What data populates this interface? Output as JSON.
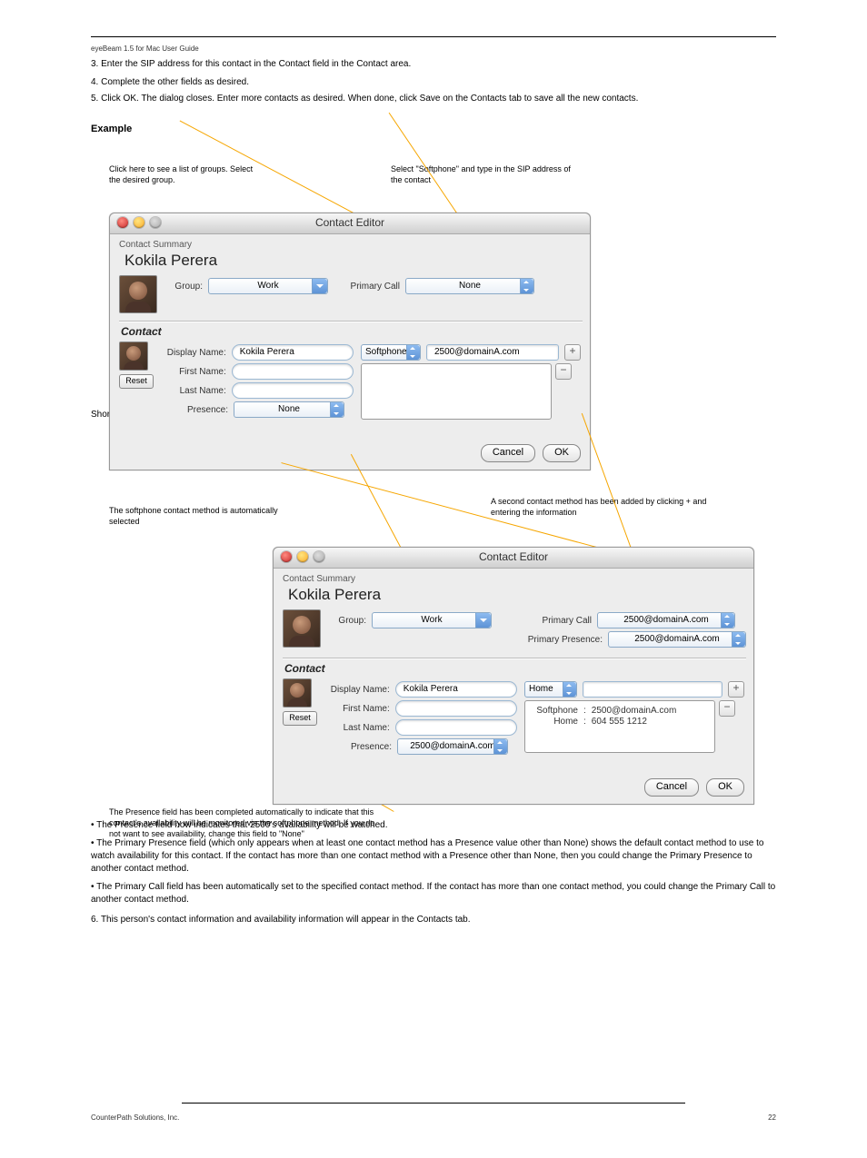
{
  "page": {
    "header_left": "eyeBeam 1.5 for Mac User Guide",
    "footer_left": "CounterPath Solutions, Inc.",
    "footer_right": "22"
  },
  "intro": {
    "p1": "3. Enter the SIP address for this contact in the Contact field in the Contact area.",
    "p2": "4. Complete the other fields as desired.",
    "p3": "5. Click OK. The dialog closes. Enter more contacts as desired. When done, click Save on the Contacts tab to save all the new contacts."
  },
  "example_heading": "Example",
  "example": {
    "p1": "Shortly after, the contact is updated. Note that:",
    "b1": "• The Presence field now indicates that 2500's availability will be watched.",
    "b2": "• The Primary Presence field (which only appears when at least one contact method has a Presence value other than None) shows the default contact method to use to watch availability for this contact. If the contact has more than one contact method with a Presence other than None, then you could change the Primary Presence to another contact method.",
    "b3": "• The Primary Call field has been automatically set to the specified contact method. If the contact has more than one contact method, you could change the Primary Call to another contact method.",
    "p2": "6. This person's contact information and availability information will appear in the Contacts tab."
  },
  "callouts": {
    "c1": "Click here to see a list of groups. Select the desired group.",
    "c2": "Select \"Softphone\" and type in the SIP address of the contact",
    "c3": "The softphone contact method is automatically selected",
    "c4": "A second contact method has been added by clicking + and entering the information",
    "c5": "The Presence field has been completed automatically to indicate that this contact's availability will be monitored via the softphone method. If you do not want to see availability, change this field to \"None\""
  },
  "dialog": {
    "title": "Contact Editor",
    "summary_label": "Contact Summary",
    "contact_name": "Kokila Perera",
    "labels": {
      "group": "Group:",
      "primary_call": "Primary Call",
      "primary_presence": "Primary Presence:",
      "display_name": "Display Name:",
      "first_name": "First Name:",
      "last_name": "Last Name:",
      "presence": "Presence:",
      "contact_section": "Contact",
      "reset": "Reset",
      "cancel": "Cancel",
      "ok": "OK"
    },
    "v1": {
      "group": "Work",
      "primary_call": "None",
      "display_name": "Kokila Perera",
      "presence": "None",
      "method_type": "Softphone",
      "method_value": "2500@domainA.com"
    },
    "v2": {
      "group": "Work",
      "primary_call": "2500@domainA.com",
      "primary_presence": "2500@domainA.com",
      "display_name": "Kokila Perera",
      "presence": "2500@domainA.com",
      "new_method_type": "Home",
      "methods": [
        {
          "type": "Softphone",
          "value": "2500@domainA.com"
        },
        {
          "type": "Home",
          "value": "604 555 1212"
        }
      ]
    }
  }
}
